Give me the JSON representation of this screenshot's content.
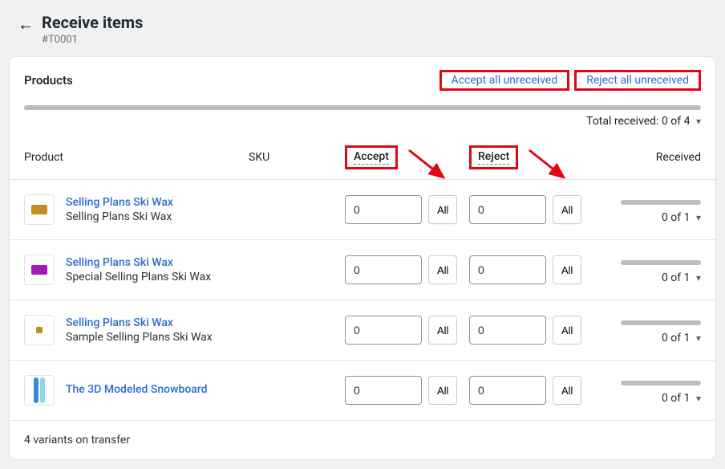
{
  "header": {
    "title": "Receive items",
    "order_id": "#T0001"
  },
  "card": {
    "title": "Products",
    "accept_all": "Accept all unreceived",
    "reject_all": "Reject all unreceived",
    "total_received": "Total received: 0 of 4"
  },
  "columns": {
    "product": "Product",
    "sku": "SKU",
    "accept": "Accept",
    "reject": "Reject",
    "received": "Received"
  },
  "rows": [
    {
      "name": "Selling Plans Ski Wax",
      "variant": "Selling Plans Ski Wax",
      "sku": "",
      "accept": "0",
      "reject": "0",
      "received": "0 of 1"
    },
    {
      "name": "Selling Plans Ski Wax",
      "variant": "Special Selling Plans Ski Wax",
      "sku": "",
      "accept": "0",
      "reject": "0",
      "received": "0 of 1"
    },
    {
      "name": "Selling Plans Ski Wax",
      "variant": "Sample Selling Plans Ski Wax",
      "sku": "",
      "accept": "0",
      "reject": "0",
      "received": "0 of 1"
    },
    {
      "name": "The 3D Modeled Snowboard",
      "variant": "",
      "sku": "",
      "accept": "0",
      "reject": "0",
      "received": "0 of 1"
    }
  ],
  "buttons": {
    "all": "All"
  },
  "footer": "4 variants on transfer"
}
